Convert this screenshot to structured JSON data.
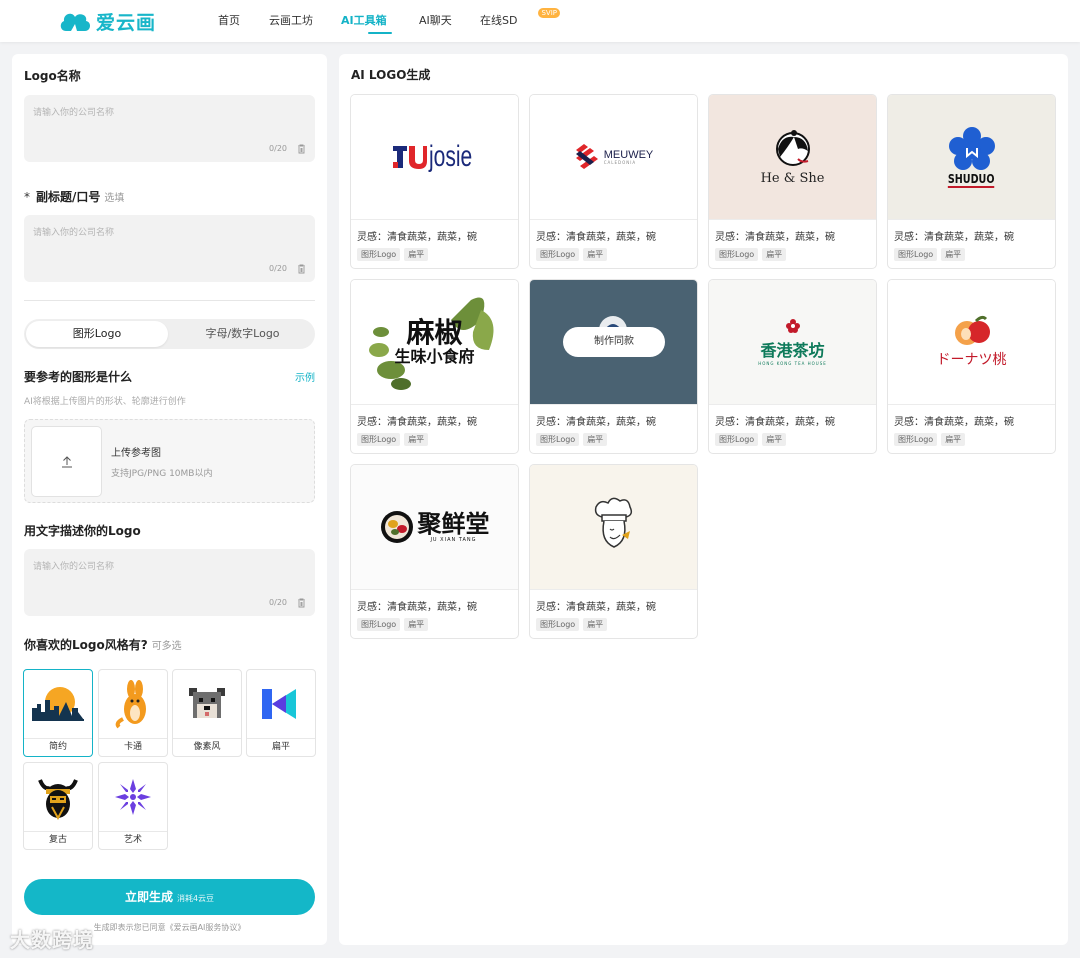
{
  "header": {
    "brand": "爱云画",
    "nav": [
      {
        "label": "首页"
      },
      {
        "label": "云画工坊"
      },
      {
        "label": "AI工具箱"
      },
      {
        "label": "AI聊天"
      },
      {
        "label": "在线SD"
      }
    ],
    "svip_badge": "SVIP"
  },
  "form": {
    "logo_name": {
      "title": "Logo名称",
      "placeholder": "请输入你的公司名称",
      "counter": "0/20"
    },
    "subtitle": {
      "star": "*",
      "title": "副标题/口号",
      "optional": "选填",
      "placeholder": "请输入你的公司名称",
      "counter": "0/20"
    },
    "mode_tabs": [
      {
        "label": "图形Logo",
        "active": true
      },
      {
        "label": "字母/数字Logo",
        "active": false
      }
    ],
    "reference": {
      "title": "要参考的图形是什么",
      "example_link": "示例",
      "hint": "AI将根据上传图片的形状、轮廓进行创作",
      "upload_title": "上传参考图",
      "upload_sub": "支持JPG/PNG 10MB以内"
    },
    "describe": {
      "title": "用文字描述你的Logo",
      "placeholder": "请输入你的公司名称",
      "counter": "0/20"
    },
    "styles": {
      "title": "你喜欢的Logo风格有?",
      "multi": "可多选",
      "items": [
        {
          "label": "简约",
          "icon": "city-skyline-icon",
          "selected": true
        },
        {
          "label": "卡通",
          "icon": "kangaroo-icon",
          "selected": false
        },
        {
          "label": "像素风",
          "icon": "pixel-dog-icon",
          "selected": false
        },
        {
          "label": "扁平",
          "icon": "flat-k-icon",
          "selected": false
        },
        {
          "label": "复古",
          "icon": "viking-icon",
          "selected": false
        },
        {
          "label": "艺术",
          "icon": "snowflake-icon",
          "selected": false
        }
      ]
    },
    "generate": {
      "label": "立即生成",
      "cost": "消耗4云豆"
    },
    "agreement": "生成即表示您已同意《爱云画AI服务协议》"
  },
  "gallery": {
    "title": "AI LOGO生成",
    "hover_button": "制作同款",
    "cards": [
      {
        "brand_text": "josie",
        "inspiration": "灵感：清食蔬菜，蔬菜，碗",
        "tags": [
          "图形Logo",
          "扁平"
        ]
      },
      {
        "brand_text": "MEUWEY",
        "brand_sub": "CALEDONIA",
        "inspiration": "灵感：清食蔬菜，蔬菜，碗",
        "tags": [
          "图形Logo",
          "扁平"
        ]
      },
      {
        "brand_text": "He & She",
        "inspiration": "灵感：清食蔬菜，蔬菜，碗",
        "tags": [
          "图形Logo",
          "扁平"
        ]
      },
      {
        "brand_text": "SHUDUO",
        "inspiration": "灵感：清食蔬菜，蔬菜，碗",
        "tags": [
          "图形Logo",
          "扁平"
        ]
      },
      {
        "brand_text": "麻椒",
        "brand_sub": "生味小食府",
        "inspiration": "灵感：清食蔬菜，蔬菜，碗",
        "tags": [
          "图形Logo",
          "扁平"
        ]
      },
      {
        "inspiration": "灵感：清食蔬菜，蔬菜，碗",
        "tags": [
          "图形Logo",
          "扁平"
        ]
      },
      {
        "brand_text": "香港茶坊",
        "brand_sub": "HONG KONG TEA HOUSE",
        "inspiration": "灵感：清食蔬菜，蔬菜，碗",
        "tags": [
          "图形Logo",
          "扁平"
        ]
      },
      {
        "brand_text": "ドーナツ桃",
        "inspiration": "灵感：清食蔬菜，蔬菜，碗",
        "tags": [
          "图形Logo",
          "扁平"
        ]
      },
      {
        "brand_text": "聚鲜堂",
        "brand_sub": "JU XIAN TANG",
        "inspiration": "灵感：清食蔬菜，蔬菜，碗",
        "tags": [
          "图形Logo",
          "扁平"
        ]
      },
      {
        "inspiration": "灵感：清食蔬菜，蔬菜，碗",
        "tags": [
          "图形Logo",
          "扁平"
        ]
      }
    ]
  },
  "watermark": "大数跨境",
  "colors": {
    "accent": "#14b7c8",
    "brand": "#18b6c9"
  }
}
